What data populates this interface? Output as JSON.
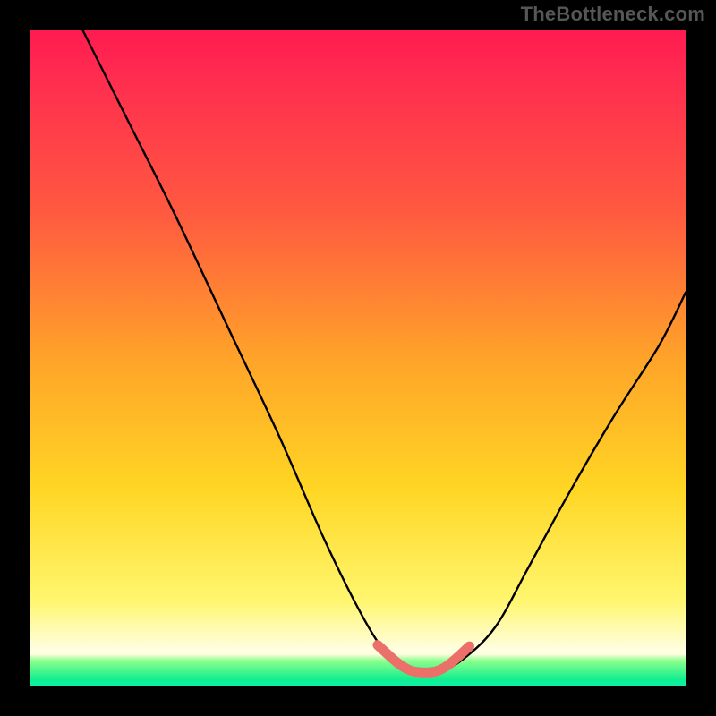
{
  "watermark": "TheBottleneck.com",
  "chart_data": {
    "type": "line",
    "title": "",
    "xlabel": "",
    "ylabel": "",
    "xlim": [
      0,
      100
    ],
    "ylim": [
      0,
      100
    ],
    "grid": false,
    "series": [
      {
        "name": "black-curve",
        "x": [
          8,
          15,
          22,
          30,
          38,
          45,
          51,
          55,
          58,
          62,
          66,
          71,
          76,
          82,
          89,
          96,
          100
        ],
        "values": [
          100,
          86,
          72,
          55,
          38,
          22,
          10,
          4,
          2,
          2,
          4,
          9,
          18,
          29,
          41,
          52,
          60
        ]
      },
      {
        "name": "pink-highlight",
        "x": [
          53,
          56,
          58,
          60,
          62,
          64,
          67
        ],
        "values": [
          6.2,
          3.5,
          2.3,
          2.0,
          2.2,
          3.3,
          6.0
        ]
      }
    ],
    "colors": {
      "gradient_top": "#ff1b50",
      "gradient_mid": "#ffd624",
      "gradient_low": "#fffee0",
      "gradient_bottom": "#13ef8f",
      "curve": "#000000",
      "highlight": "#ea7069",
      "watermark": "#565656"
    }
  }
}
